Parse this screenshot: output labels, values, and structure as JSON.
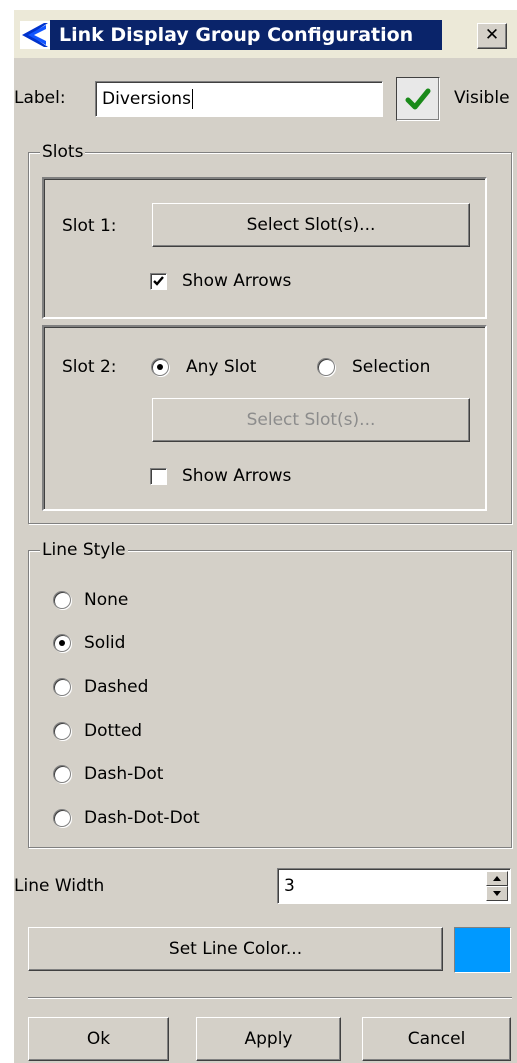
{
  "window": {
    "title": "Link Display Group Configuration",
    "close_glyph": "✕"
  },
  "label_row": {
    "label": "Label:",
    "value": "Diversions",
    "visible_label": "Visible"
  },
  "slots": {
    "legend": "Slots",
    "slot1": {
      "label": "Slot 1:",
      "button": "Select Slot(s)...",
      "show_arrows": "Show Arrows",
      "show_arrows_checked": true
    },
    "slot2": {
      "label": "Slot 2:",
      "any_slot": "Any Slot",
      "selection": "Selection",
      "mode": "Any Slot",
      "button": "Select Slot(s)...",
      "show_arrows": "Show Arrows",
      "show_arrows_checked": false
    }
  },
  "line_style": {
    "legend": "Line Style",
    "options": [
      "None",
      "Solid",
      "Dashed",
      "Dotted",
      "Dash-Dot",
      "Dash-Dot-Dot"
    ],
    "selected": "Solid"
  },
  "line_width": {
    "label": "Line Width",
    "value": "3"
  },
  "line_color": {
    "button": "Set Line Color...",
    "color": "#0099ff"
  },
  "buttons": {
    "ok": "Ok",
    "apply": "Apply",
    "cancel": "Cancel"
  },
  "icons": {
    "app_logo": "riverware-logo",
    "visible_toggle": "check-icon"
  }
}
